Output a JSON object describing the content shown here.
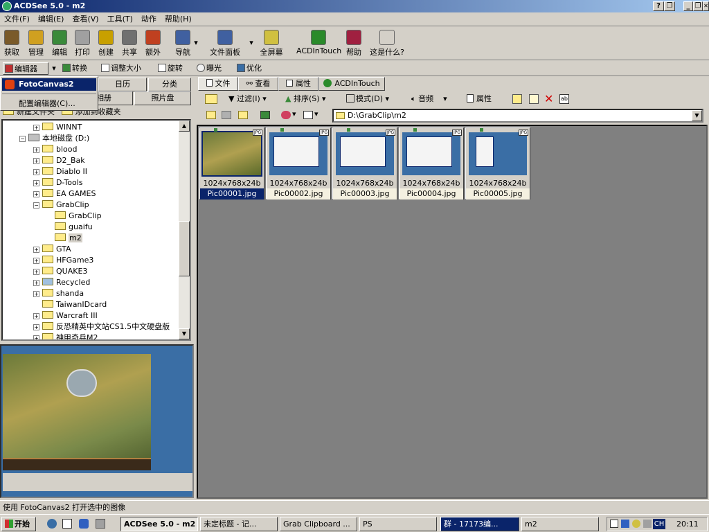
{
  "window": {
    "title": "ACDSee 5.0 - m2"
  },
  "menu": [
    "文件(F)",
    "编辑(E)",
    "查看(V)",
    "工具(T)",
    "动作",
    "帮助(H)"
  ],
  "toolbar": [
    {
      "label": "获取",
      "icon": "acquire-icon",
      "color": "#7a5a2a"
    },
    {
      "label": "管理",
      "icon": "manage-icon",
      "color": "#d0a020"
    },
    {
      "label": "编辑",
      "icon": "edit-icon",
      "color": "#3a8a3a"
    },
    {
      "label": "打印",
      "icon": "print-icon",
      "color": "#a0a0a0"
    },
    {
      "label": "创建",
      "icon": "create-icon",
      "color": "#c8a000"
    },
    {
      "label": "共享",
      "icon": "share-icon",
      "color": "#707070"
    },
    {
      "label": "额外",
      "icon": "extra-icon",
      "color": "#c04020"
    },
    {
      "label": "导航",
      "icon": "navigate-icon",
      "color": "#4060a0"
    },
    {
      "label": "文件面板",
      "icon": "file-panel-icon",
      "color": "#4060a0"
    },
    {
      "label": "全屏幕",
      "icon": "fullscreen-icon",
      "color": "#d0c040"
    },
    {
      "label": "ACDInTouch",
      "icon": "acdintouch-icon",
      "color": "#2a8a2a"
    },
    {
      "label": "帮助",
      "icon": "help-icon",
      "color": "#a02040"
    },
    {
      "label": "这是什么?",
      "icon": "whats-this-icon",
      "color": "#d4d0c8"
    }
  ],
  "toolbar2": [
    "编辑器",
    "转换",
    "调整大小",
    "旋转",
    "曝光",
    "优化"
  ],
  "dropdown": {
    "item1": "FotoCanvas2",
    "item2": "配置编辑器(C)..."
  },
  "left_tabs": [
    "日历",
    "分类",
    "相册",
    "照片盘"
  ],
  "left_tabs_partial": [
    "新建文件夹",
    "添加到收藏夹"
  ],
  "tree": [
    {
      "label": "WINNT",
      "level": 2,
      "exp": "+"
    },
    {
      "label": "本地磁盘 (D:)",
      "level": 1,
      "exp": "-",
      "drive": true
    },
    {
      "label": "blood",
      "level": 2,
      "exp": "+"
    },
    {
      "label": "D2_Bak",
      "level": 2,
      "exp": "+"
    },
    {
      "label": "Diablo II",
      "level": 2,
      "exp": "+"
    },
    {
      "label": "D-Tools",
      "level": 2,
      "exp": "+"
    },
    {
      "label": "EA GAMES",
      "level": 2,
      "exp": "+"
    },
    {
      "label": "GrabClip",
      "level": 2,
      "exp": "-"
    },
    {
      "label": "GrabClip",
      "level": 3,
      "exp": ""
    },
    {
      "label": "guaifu",
      "level": 3,
      "exp": ""
    },
    {
      "label": "m2",
      "level": 3,
      "exp": "",
      "selected": true
    },
    {
      "label": "GTA",
      "level": 2,
      "exp": "+"
    },
    {
      "label": "HFGame3",
      "level": 2,
      "exp": "+"
    },
    {
      "label": "QUAKE3",
      "level": 2,
      "exp": "+"
    },
    {
      "label": "Recycled",
      "level": 2,
      "exp": "+"
    },
    {
      "label": "shanda",
      "level": 2,
      "exp": "+"
    },
    {
      "label": "TaiwanIDcard",
      "level": 2,
      "exp": ""
    },
    {
      "label": "Warcraft III",
      "level": 2,
      "exp": "+"
    },
    {
      "label": "反恐精英中文站CS1.5中文硬盘版",
      "level": 2,
      "exp": "+"
    },
    {
      "label": "神甲奇兵M2",
      "level": 2,
      "exp": "+"
    }
  ],
  "right_tabs": [
    "文件",
    "查看",
    "属性",
    "ACDInTouch"
  ],
  "right_toolbar": [
    "过滤(I)",
    "排序(S)",
    "模式(D)",
    "音频",
    "属性"
  ],
  "address": "D:\\GrabClip\\m2",
  "files": [
    {
      "dim": "1024x768x24b",
      "name": "Pic00001.jpg",
      "selected": true
    },
    {
      "dim": "1024x768x24b",
      "name": "Pic00002.jpg"
    },
    {
      "dim": "1024x768x24b",
      "name": "Pic00003.jpg"
    },
    {
      "dim": "1024x768x24b",
      "name": "Pic00004.jpg"
    },
    {
      "dim": "1024x768x24b",
      "name": "Pic00005.jpg"
    }
  ],
  "jpg_badge": "JPG",
  "status": "使用 FotoCanvas2 打开选中的图像",
  "taskbar": {
    "start": "开始",
    "tasks": [
      "ACDSee 5.0 - m2",
      "未定标题 - 记...",
      "Grab Clipboard ...",
      "PS",
      "群 - 17173编...",
      "m2"
    ],
    "tray_lang": "CH",
    "clock": "20:11"
  }
}
